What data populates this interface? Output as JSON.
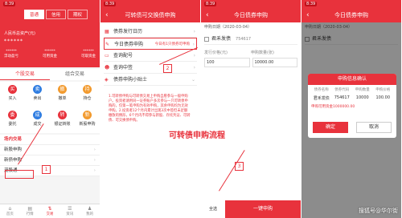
{
  "status": {
    "time": "8:39"
  },
  "p1": {
    "acct_tabs": [
      "普通",
      "信用",
      "期权"
    ],
    "asset_label": "人民币总资产(元)",
    "asset_value": "******",
    "asset_stats": [
      {
        "value": "******",
        "label": "浮动盈亏"
      },
      {
        "value": "******",
        "label": "可用资金"
      },
      {
        "value": "******",
        "label": "可取资金"
      }
    ],
    "sec_tabs": [
      "个股交易",
      "组合交易"
    ],
    "grid": [
      {
        "label": "买入",
        "icon": "买",
        "color": "#e8323c"
      },
      {
        "label": "卖出",
        "icon": "卖",
        "color": "#2f7de1"
      },
      {
        "label": "撤单",
        "icon": "撤",
        "color": "#f29a2e"
      },
      {
        "label": "持仓",
        "icon": "持",
        "color": "#f29a2e"
      },
      {
        "label": "委托",
        "icon": "委",
        "color": "#e8323c"
      },
      {
        "label": "成交",
        "icon": "成",
        "color": "#2f7de1"
      },
      {
        "label": "银证转账",
        "icon": "转",
        "color": "#e8323c"
      },
      {
        "label": "新股申购",
        "icon": "新",
        "color": "#f29a2e"
      }
    ],
    "list": [
      "场内交易",
      "新股申购",
      "新债申购",
      "港股通"
    ],
    "bottom_nav": [
      {
        "label": "首页",
        "icon": "⌂"
      },
      {
        "label": "行情",
        "icon": "▤"
      },
      {
        "label": "交易",
        "icon": "⇅"
      },
      {
        "label": "资讯",
        "icon": "☰"
      },
      {
        "label": "我的",
        "icon": "♟"
      }
    ]
  },
  "p2": {
    "title": "可转债可交换债申购",
    "menu": [
      {
        "label": "债券发行日历",
        "icon": "▦",
        "hint": ""
      },
      {
        "label": "今日债券申购",
        "icon": "✎",
        "hint": "今日有1只债券可申购"
      },
      {
        "label": "查询配号",
        "icon": "▭",
        "hint": ""
      },
      {
        "label": "查询中签",
        "icon": "☻",
        "hint": ""
      },
      {
        "label": "债券申购小贴士",
        "icon": "◈",
        "hint": ""
      }
    ],
    "tips": "1.可转债申购与可转债交易上申购自愿参与一般申购户。投资者请用同一证券账户多次参与一只可转债申购的，仅第一笔申购为有效申购，其余申购均为无效申购。2.投资者12个月内累计出现3次中签但未足额缴款的情形，6个月内不得参与新股、存托凭证、可转债、可交换债申购。",
    "flow_title": "可转债申购流程"
  },
  "p3": {
    "title": "今日债券申购",
    "date": "申购日期（2020-03-04）",
    "bond_name": "君禾发债",
    "bond_code": "754617",
    "field_headers": [
      "发行价格(元)",
      "申购数量(张)"
    ],
    "price": "100",
    "qty": "10000.00",
    "select_all": "全选",
    "submit": "一键申购"
  },
  "p4": {
    "title": "今日债券申购",
    "date": "申购日期（2020-03-04）",
    "bond_name": "君禾发债",
    "dialog_title": "申购信息确认",
    "dialog_headers": [
      "债券名称",
      "债券代码",
      "申购数量",
      "申购价格"
    ],
    "dialog_values": [
      "君禾发债",
      "754617",
      "10000",
      "100.00"
    ],
    "dialog_note": "申购可用资金1000000.00",
    "confirm": "确定",
    "cancel": "取消",
    "select_all": "全选"
  },
  "callouts": [
    "1",
    "2",
    "3"
  ],
  "watermark": "搜狐号@华尔街"
}
